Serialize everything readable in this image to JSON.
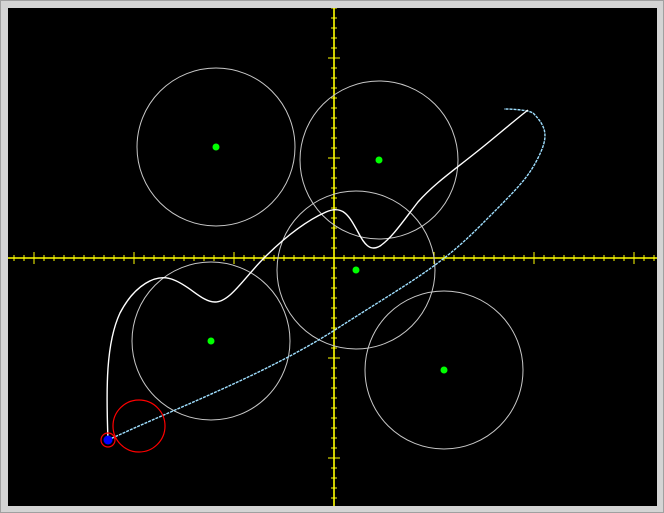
{
  "colors": {
    "frame": "#d4d4d4",
    "background": "#000000",
    "axis": "#ffff00",
    "obstacle_circle": "#c8c8c8",
    "obstacle_center": "#00ff00",
    "path_direct": "#ffffff",
    "path_planned": "#9fdfff",
    "robot_ring": "#ff0000",
    "robot_dot": "#0000ff"
  },
  "scene": {
    "icon_semantics": {
      "axes": "crosshair-axes",
      "obstacles": "circle-obstacle-icon",
      "robot": "robot-marker-icon"
    }
  }
}
